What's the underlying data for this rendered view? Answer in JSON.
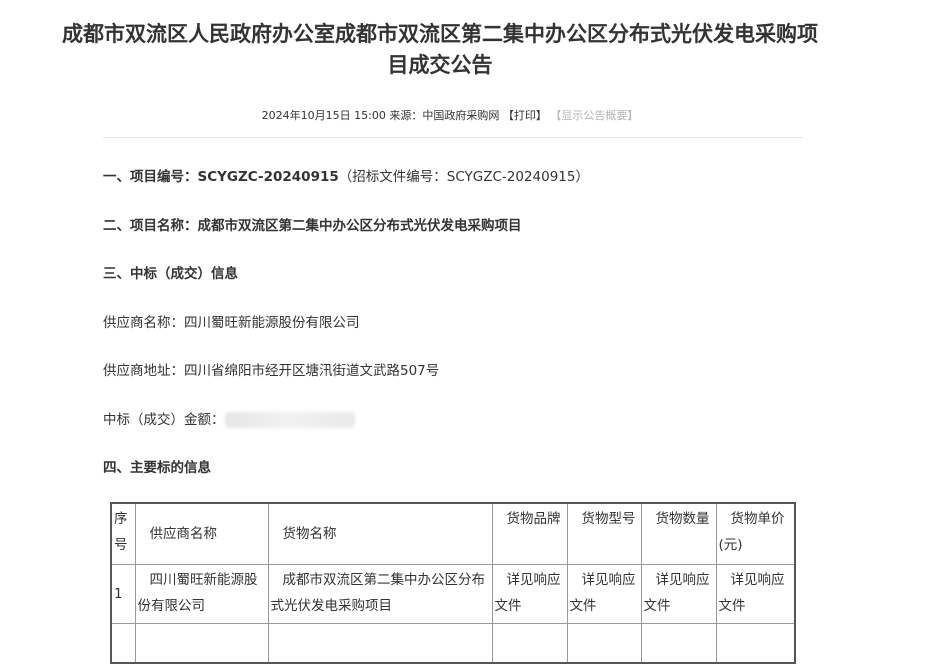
{
  "header": {
    "title_line1": "成都市双流区人民政府办公室成都市双流区第二集中办公区分布式光伏发电采购项",
    "title_line2": "目成交公告",
    "date": "2024年10月15日 15:00",
    "source": "来源：中国政府采购网",
    "print_label": "【打印】",
    "summary_label": "【显示公告概要】"
  },
  "sections": {
    "project_no_label": "一、项目编号：",
    "project_no_value": "SCYGZC-20240915",
    "tender_doc_no": "（招标文件编号：SCYGZC-20240915）",
    "project_name_label": "二、项目名称：",
    "project_name_value": "成都市双流区第二集中办公区分布式光伏发电采购项目",
    "award_info_label": "三、中标（成交）信息",
    "supplier_name": "供应商名称：四川蜀旺新能源股份有限公司",
    "supplier_address": "供应商地址：四川省绵阳市经开区塘汛街道文武路507号",
    "amount_label": "中标（成交）金额：",
    "main_items_label": "四、主要标的信息"
  },
  "table": {
    "headers": [
      "序号",
      "供应商名称",
      "货物名称",
      "货物品牌",
      "货物型号",
      "货物数量",
      "货物单价(元)"
    ],
    "rows": [
      [
        "1",
        "四川蜀旺新能源股份有限公司",
        "成都市双流区第二集中办公区分布式光伏发电采购项目",
        "详见响应文件",
        "详见响应文件",
        "详见响应文件",
        "详见响应文件"
      ]
    ]
  }
}
